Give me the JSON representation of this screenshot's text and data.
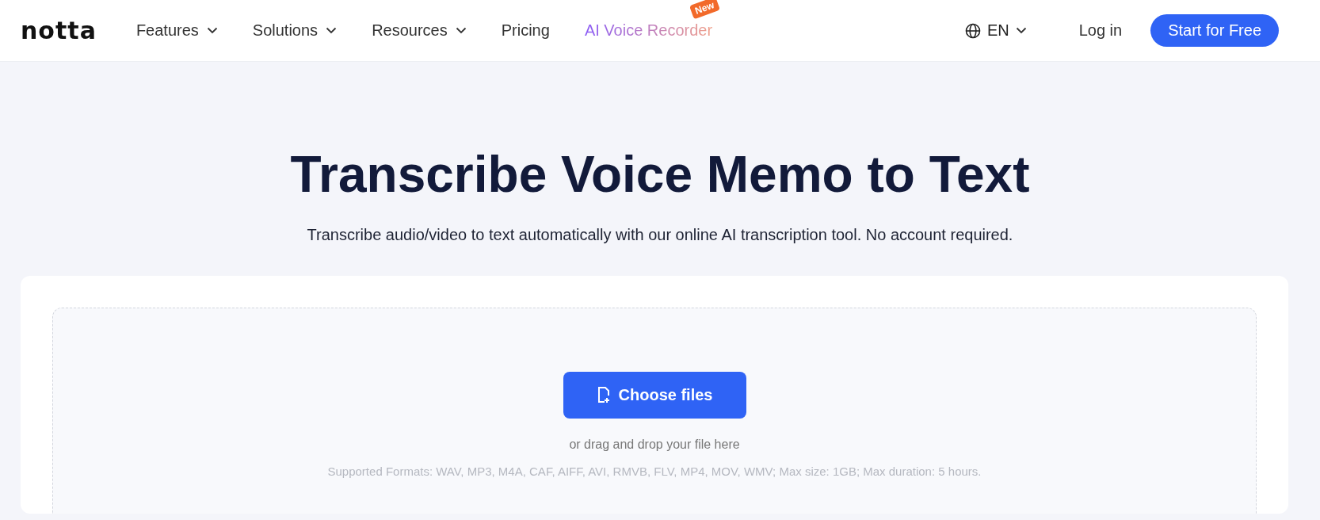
{
  "header": {
    "logo": "notta",
    "nav": [
      {
        "label": "Features",
        "kind": "dropdown"
      },
      {
        "label": "Solutions",
        "kind": "dropdown"
      },
      {
        "label": "Resources",
        "kind": "dropdown"
      },
      {
        "label": "Pricing",
        "kind": "link"
      },
      {
        "label": "AI Voice Recorder",
        "kind": "highlight",
        "badge": "New"
      }
    ],
    "language": "EN",
    "login": "Log in",
    "cta": "Start for Free"
  },
  "hero": {
    "title": "Transcribe Voice Memo to Text",
    "subtitle": "Transcribe audio/video to text automatically with our online AI transcription tool. No account required."
  },
  "upload": {
    "button": "Choose files",
    "hint": "or drag and drop your file here",
    "formats": "Supported Formats: WAV, MP3, M4A, CAF, AIFF, AVI, RMVB, FLV, MP4, MOV, WMV; Max size: 1GB; Max duration: 5 hours."
  }
}
